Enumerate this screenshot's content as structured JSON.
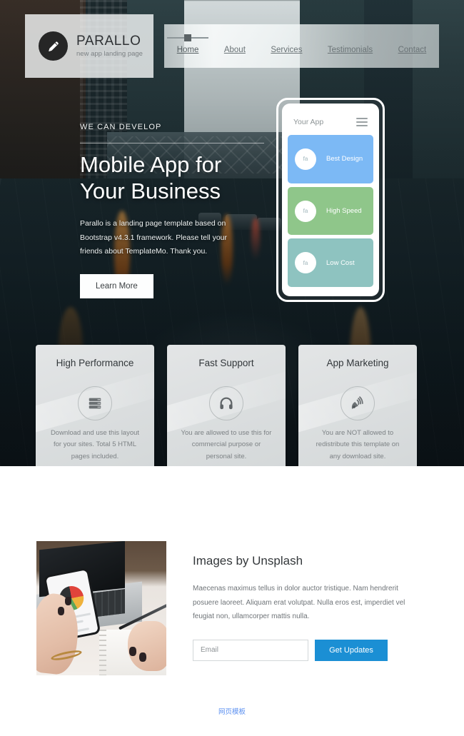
{
  "brand": {
    "logo_icon": "pencil-icon",
    "title": "PARALLO",
    "subtitle": "new app landing page"
  },
  "nav": {
    "items": [
      {
        "label": "Home",
        "active": true
      },
      {
        "label": "About",
        "active": false
      },
      {
        "label": "Services",
        "active": false
      },
      {
        "label": "Testimonials",
        "active": false
      },
      {
        "label": "Contact",
        "active": false
      }
    ]
  },
  "hero": {
    "overline": "WE CAN DEVELOP",
    "title_line1": "Mobile App for",
    "title_line2": "Your Business",
    "description": "Parallo is a landing page template based on Bootstrap v4.3.1 framework. Please tell your friends about TemplateMo. Thank you.",
    "cta_label": "Learn More"
  },
  "phone": {
    "app_name": "Your App",
    "menu_icon": "hamburger-icon",
    "cards": [
      {
        "label": "Best Design",
        "bubble": "fa",
        "color": "#7cb9f5"
      },
      {
        "label": "High Speed",
        "bubble": "fa",
        "color": "#8fc68a"
      },
      {
        "label": "Low Cost",
        "bubble": "fa",
        "color": "#8ec3c0"
      }
    ]
  },
  "features": [
    {
      "title": "High Performance",
      "icon": "server-icon",
      "description": "Download and use this layout for your sites. Total 5 HTML pages included."
    },
    {
      "title": "Fast Support",
      "icon": "headphones-icon",
      "description": "You are allowed to use this for commercial purpose or personal site."
    },
    {
      "title": "App Marketing",
      "icon": "satellite-dish-icon",
      "description": "You are NOT allowed to redistribute this template on any download site."
    }
  ],
  "lower": {
    "image_alt": "hand-holding-phone-over-laptop-photo",
    "title": "Images by Unsplash",
    "description": "Maecenas maximus tellus in dolor auctor tristique. Nam hendrerit posuere laoreet. Aliquam erat volutpat. Nulla eros est, imperdiet vel feugiat non, ullamcorper mattis nulla.",
    "email_placeholder": "Email",
    "email_value": "",
    "submit_label": "Get Updates"
  },
  "footer": {
    "link_label": "网页模板",
    "link_color": "#5a8ff0"
  },
  "colors": {
    "accent_blue": "#1b8fd4",
    "card_blue": "#7cb9f5",
    "card_green": "#8fc68a",
    "card_teal": "#8ec3c0",
    "hero_dark": "#16222 6"
  }
}
